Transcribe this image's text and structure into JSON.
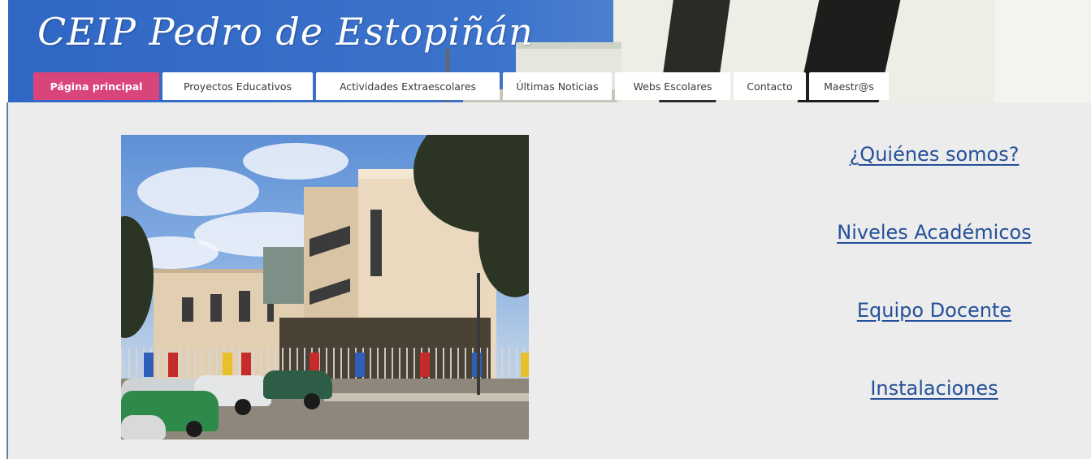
{
  "site": {
    "title": "CEIP Pedro de Estopiñán"
  },
  "nav": {
    "tabs": [
      {
        "label": "Página principal",
        "active": true
      },
      {
        "label": "Proyectos Educativos",
        "active": false
      },
      {
        "label": "Actividades Extraescolares",
        "active": false
      },
      {
        "label": "Últimas Noticias",
        "active": false
      },
      {
        "label": "Webs Escolares",
        "active": false
      },
      {
        "label": "Contacto",
        "active": false
      },
      {
        "label": "Maestr@s",
        "active": false
      }
    ]
  },
  "main": {
    "links": [
      {
        "label": "¿Quiénes somos?"
      },
      {
        "label": "Niveles Académicos"
      },
      {
        "label": "Equipo Docente"
      },
      {
        "label": "Instalaciones"
      }
    ]
  },
  "colors": {
    "active_tab": "#d9457a",
    "link": "#24509a",
    "header_blue": "#3c73cc",
    "content_bg": "#ececec"
  }
}
